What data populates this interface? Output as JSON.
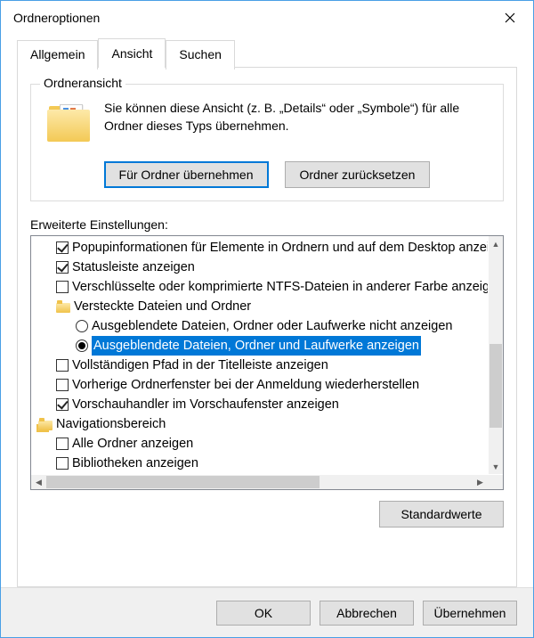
{
  "window": {
    "title": "Ordneroptionen"
  },
  "tabs": {
    "general": "Allgemein",
    "view": "Ansicht",
    "search": "Suchen"
  },
  "folderView": {
    "legend": "Ordneransicht",
    "description": "Sie können diese Ansicht (z. B. „Details“ oder „Symbole“) für alle Ordner dieses Typs übernehmen.",
    "applyBtn": "Für Ordner übernehmen",
    "resetBtn": "Ordner zurücksetzen"
  },
  "advanced": {
    "label": "Erweiterte Einstellungen:",
    "items": [
      {
        "kind": "check",
        "checked": true,
        "indent": 1,
        "text": "Popupinformationen für Elemente in Ordnern und auf dem Desktop anzeigen"
      },
      {
        "kind": "check",
        "checked": true,
        "indent": 1,
        "text": "Statusleiste anzeigen"
      },
      {
        "kind": "check",
        "checked": false,
        "indent": 1,
        "text": "Verschlüsselte oder komprimierte NTFS-Dateien in anderer Farbe anzeigen"
      },
      {
        "kind": "folder",
        "checked": false,
        "indent": 1,
        "text": "Versteckte Dateien und Ordner"
      },
      {
        "kind": "radio",
        "checked": false,
        "indent": 2,
        "text": "Ausgeblendete Dateien, Ordner oder Laufwerke nicht anzeigen"
      },
      {
        "kind": "radio",
        "checked": true,
        "indent": 2,
        "text": "Ausgeblendete Dateien, Ordner und Laufwerke anzeigen",
        "selected": true
      },
      {
        "kind": "check",
        "checked": false,
        "indent": 1,
        "text": "Vollständigen Pfad in der Titelleiste anzeigen"
      },
      {
        "kind": "check",
        "checked": false,
        "indent": 1,
        "text": "Vorherige Ordnerfenster bei der Anmeldung wiederherstellen"
      },
      {
        "kind": "check",
        "checked": true,
        "indent": 1,
        "text": "Vorschauhandler im Vorschaufenster anzeigen"
      },
      {
        "kind": "folder-dual",
        "checked": false,
        "indent": 0,
        "text": "Navigationsbereich"
      },
      {
        "kind": "check",
        "checked": false,
        "indent": 1,
        "text": "Alle Ordner anzeigen"
      },
      {
        "kind": "check",
        "checked": false,
        "indent": 1,
        "text": "Bibliotheken anzeigen"
      }
    ],
    "defaultsBtn": "Standardwerte"
  },
  "buttons": {
    "ok": "OK",
    "cancel": "Abbrechen",
    "apply": "Übernehmen"
  }
}
